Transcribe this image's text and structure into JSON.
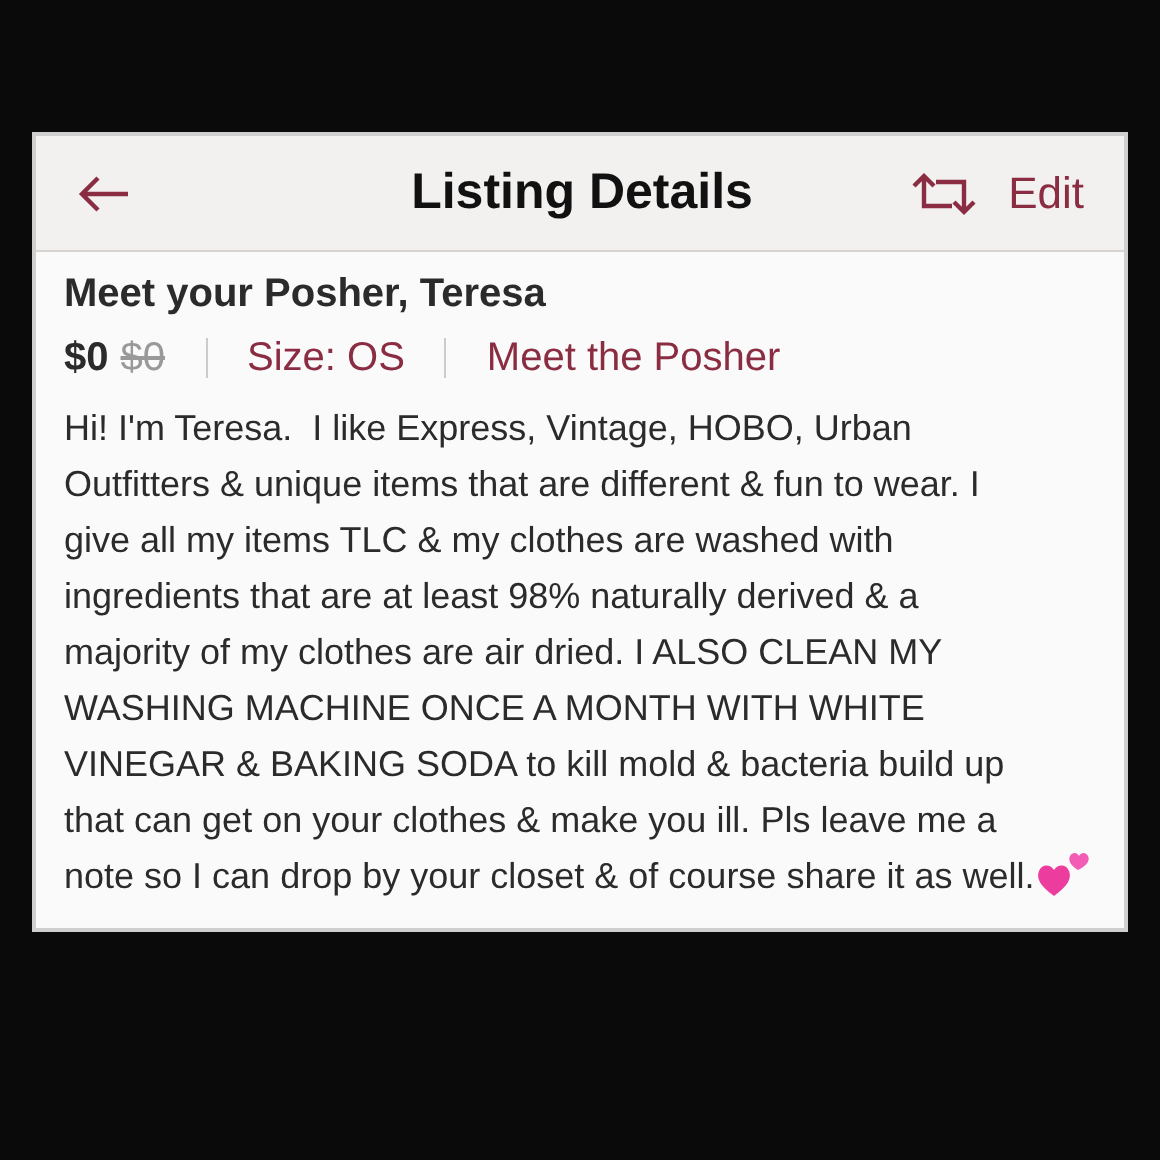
{
  "header": {
    "title": "Listing Details",
    "action": "Edit"
  },
  "listing": {
    "title": "Meet your Posher, Teresa",
    "price": "$0",
    "original_price": "$0",
    "size": "Size: OS",
    "link": "Meet the Posher",
    "description": "Hi! I'm Teresa.  I like Express, Vintage, HOBO, Urban Outfitters & unique items that are different & fun to wear. I give all my items TLC & my clothes are washed with ingredients that are at least 98% naturally derived & a majority of my clothes are air dried. I ALSO CLEAN MY WASHING MACHINE ONCE A MONTH WITH WHITE VINEGAR & BAKING SODA to kill mold & bacteria build up that can get on your clothes & make you ill. Pls leave me a note so I can drop by your closet & of course share it as well."
  }
}
